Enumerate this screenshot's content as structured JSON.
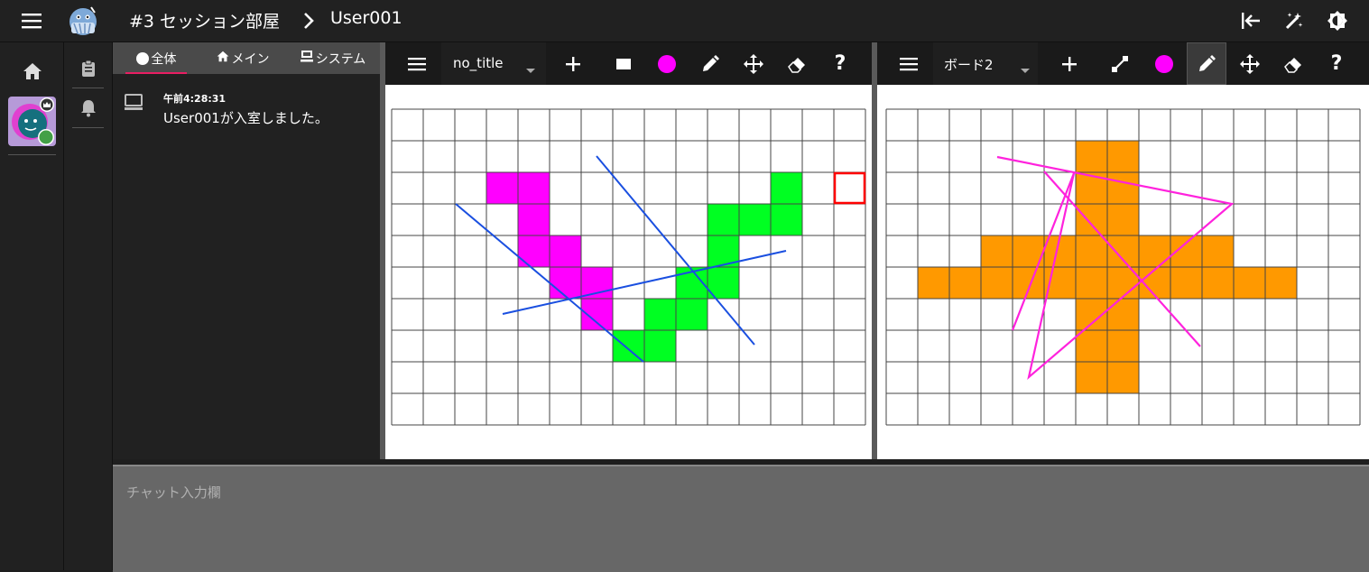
{
  "header": {
    "room_title": "#3 セッション部屋",
    "user_title": "User001"
  },
  "chat": {
    "tabs": [
      {
        "label": "全体"
      },
      {
        "label": "メイン"
      },
      {
        "label": "システム"
      }
    ],
    "messages": [
      {
        "time": "午前4:28:31",
        "text": "User001が入室しました。"
      }
    ],
    "input_placeholder": "チャット入力欄"
  },
  "boards": [
    {
      "title": "no_title",
      "color": "#ff00ff",
      "painted_cells": [
        {
          "col": 3,
          "row": 2,
          "color": "#ff00ff"
        },
        {
          "col": 4,
          "row": 2,
          "color": "#ff00ff"
        },
        {
          "col": 4,
          "row": 3,
          "color": "#ff00ff"
        },
        {
          "col": 4,
          "row": 4,
          "color": "#ff00ff"
        },
        {
          "col": 5,
          "row": 4,
          "color": "#ff00ff"
        },
        {
          "col": 5,
          "row": 5,
          "color": "#ff00ff"
        },
        {
          "col": 6,
          "row": 5,
          "color": "#ff00ff"
        },
        {
          "col": 6,
          "row": 6,
          "color": "#ff00ff"
        },
        {
          "col": 7,
          "row": 7,
          "color": "#00ff22"
        },
        {
          "col": 8,
          "row": 7,
          "color": "#00ff22"
        },
        {
          "col": 8,
          "row": 6,
          "color": "#00ff22"
        },
        {
          "col": 9,
          "row": 6,
          "color": "#00ff22"
        },
        {
          "col": 9,
          "row": 5,
          "color": "#00ff22"
        },
        {
          "col": 10,
          "row": 5,
          "color": "#00ff22"
        },
        {
          "col": 10,
          "row": 4,
          "color": "#00ff22"
        },
        {
          "col": 10,
          "row": 3,
          "color": "#00ff22"
        },
        {
          "col": 11,
          "row": 3,
          "color": "#00ff22"
        },
        {
          "col": 12,
          "row": 3,
          "color": "#00ff22"
        },
        {
          "col": 12,
          "row": 2,
          "color": "#00ff22"
        }
      ],
      "cursor_cell": {
        "col": 14,
        "row": 2,
        "color": "#ff0000"
      },
      "line_color": "#1a4fe0"
    },
    {
      "title": "ボード2",
      "color": "#ff00ff",
      "fill_color": "#ff9900",
      "line_color": "#ff22dd"
    }
  ]
}
